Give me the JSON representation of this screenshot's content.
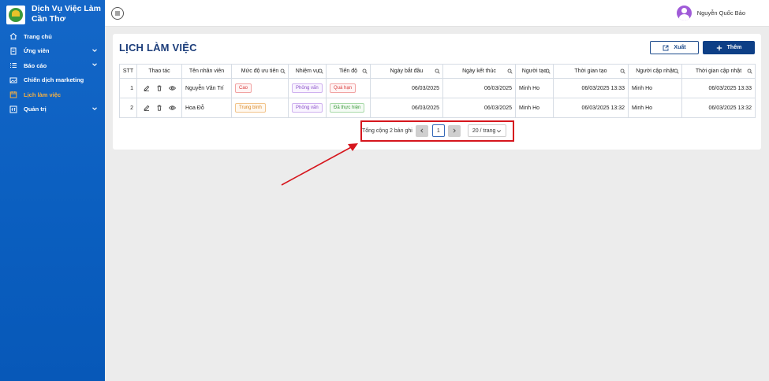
{
  "sidebar": {
    "brand_line1": "Dịch Vụ Việc Làm",
    "brand_line2": "Cần Thơ",
    "items": [
      {
        "label": "Trang chủ",
        "icon": "home-icon",
        "expandable": false,
        "active": false
      },
      {
        "label": "Ứng viên",
        "icon": "document-icon",
        "expandable": true,
        "active": false
      },
      {
        "label": "Báo cáo",
        "icon": "list-icon",
        "expandable": true,
        "active": false
      },
      {
        "label": "Chiến dịch marketing",
        "icon": "image-icon",
        "expandable": false,
        "active": false
      },
      {
        "label": "Lịch làm việc",
        "icon": "calendar-icon",
        "expandable": false,
        "active": true
      },
      {
        "label": "Quản trị",
        "icon": "admin-icon",
        "expandable": true,
        "active": false
      }
    ]
  },
  "topbar": {
    "user_name": "Nguyễn Quốc Bảo"
  },
  "page": {
    "title": "LỊCH LÀM VIỆC",
    "export_label": "Xuất",
    "add_label": "Thêm"
  },
  "table": {
    "headers": [
      "STT",
      "Thao tác",
      "Tên nhân viên",
      "Mức độ ưu tiên",
      "Nhiệm vụ",
      "Tiến độ",
      "Ngày bắt đầu",
      "Ngày kết thúc",
      "Người tạo",
      "Thời gian tạo",
      "Người cập nhật",
      "Thời gian cập nhật"
    ],
    "rows": [
      {
        "stt": "1",
        "name": "Nguyễn Văn Trí",
        "priority": "Cao",
        "task": "Phỏng vấn",
        "progress": "Quá hạn",
        "start": "06/03/2025",
        "end": "06/03/2025",
        "creator": "Minh Ho",
        "created": "06/03/2025 13:33",
        "updater": "Minh Ho",
        "updated": "06/03/2025 13:33"
      },
      {
        "stt": "2",
        "name": "Hoa Đỗ",
        "priority": "Trung bình",
        "task": "Phỏng vấn",
        "progress": "Đã thực hiện",
        "start": "06/03/2025",
        "end": "06/03/2025",
        "creator": "Minh Ho",
        "created": "06/03/2025 13:32",
        "updater": "Minh Ho",
        "updated": "06/03/2025 13:32"
      }
    ]
  },
  "pagination": {
    "total_text": "Tổng cộng 2 bản ghi",
    "current_page": "1",
    "page_size": "20 / trang"
  },
  "colors": {
    "sidebar": "#0b5fc0",
    "active_menu": "#f6b042",
    "primary_button": "#0e3f86",
    "highlight": "#d6161d"
  }
}
